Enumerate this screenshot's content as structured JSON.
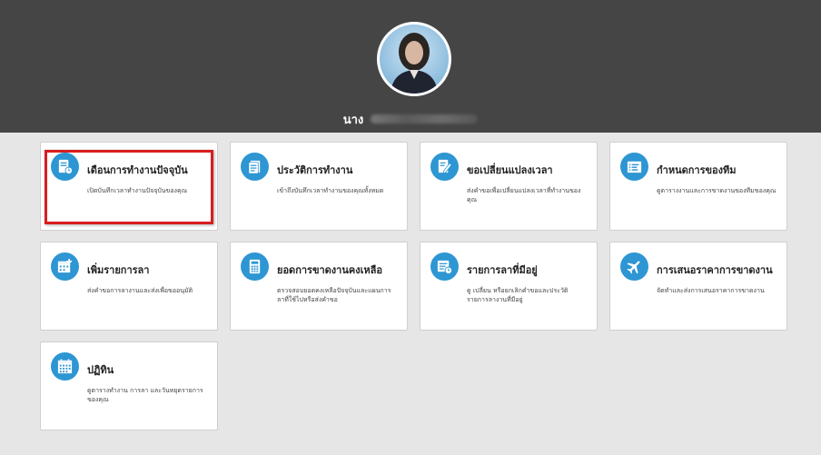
{
  "header": {
    "name_prefix": "นาง"
  },
  "tiles": [
    {
      "title": "เดือนการทำงานปัจจุบัน",
      "desc": "เปิดบันทึกเวลาทำงานปัจจุบันของคุณ",
      "icon": "current-timecard-icon"
    },
    {
      "title": "ประวัติการทำงาน",
      "desc": "เข้าถึงบันทึกเวลาทำงานของคุณทั้งหมด",
      "icon": "work-history-icon"
    },
    {
      "title": "ขอเปลี่ยนแปลงเวลา",
      "desc": "ส่งคำขอเพื่อเปลี่ยนแปลงเวลาที่ทำงานของคุณ",
      "icon": "time-change-request-icon"
    },
    {
      "title": "กำหนดการของทีม",
      "desc": "ดูตารางงานและการขาดงานของทีมของคุณ",
      "icon": "team-schedule-icon"
    },
    {
      "title": "เพิ่มรายการลา",
      "desc": "ส่งคำขอการลางานและส่งเพื่อขออนุมัติ",
      "icon": "add-leave-icon"
    },
    {
      "title": "ยอดการขาดงานคงเหลือ",
      "desc": "ตรวจสอบยอดคงเหลือปัจจุบันและแผนการลาที่ใช้ไปหรือส่งคำขอ",
      "icon": "absence-balance-icon"
    },
    {
      "title": "รายการลาที่มีอยู่",
      "desc": "ดู เปลี่ยน หรือยกเลิกคำขอและประวัติรายการลางานที่มีอยู่",
      "icon": "existing-leave-icon"
    },
    {
      "title": "การเสนอราคาการขาดงาน",
      "desc": "จัดทำและส่งการเสนอราคาการขาดงาน",
      "icon": "absence-bid-icon"
    },
    {
      "title": "ปฏิทิน",
      "desc": "ดูตารางทำงาน การลา และวันหยุดรายการของคุณ",
      "icon": "calendar-icon"
    }
  ],
  "colors": {
    "header_bg": "#454545",
    "icon_bg": "#2d96d3",
    "highlight_border": "#d81e1e"
  }
}
